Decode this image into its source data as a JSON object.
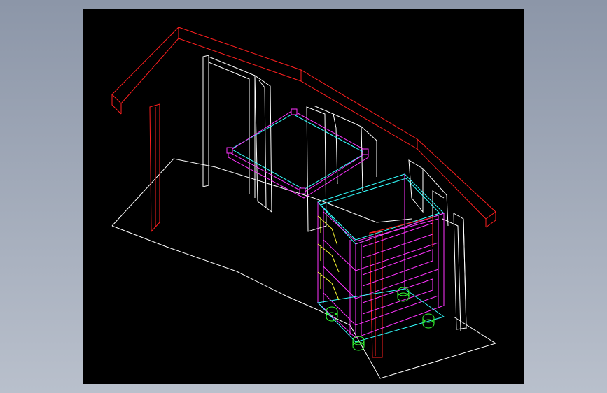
{
  "window": {
    "background_color": "#000000",
    "frame_gradient": [
      "#8c96a8",
      "#b9c0cc"
    ]
  },
  "layer_colors": {
    "desk_top": "#ff1f1f",
    "panels": "#ffffff",
    "shelf": "#33ffff",
    "drawer_frame": "#ff33ff",
    "handles": "#ffff33",
    "casters": "#33ff33"
  },
  "icons": [
    "3d-wireframe-desk-drawing"
  ]
}
